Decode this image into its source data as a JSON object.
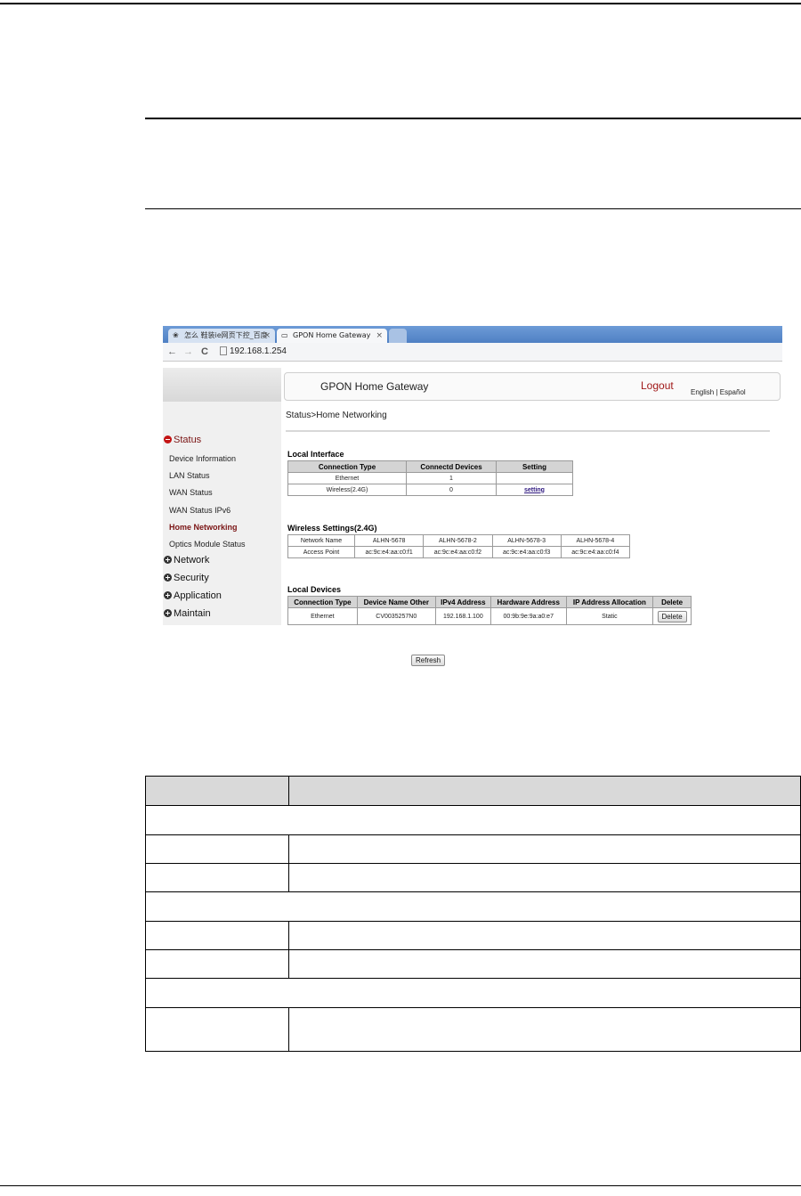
{
  "browser": {
    "tabs": [
      {
        "label": "怎么 鞋装ie网页下控_百度",
        "close": "×"
      },
      {
        "label": "GPON Home Gateway",
        "close": "×"
      }
    ],
    "nav": {
      "back": "←",
      "forward": "→",
      "reload": "C"
    },
    "url": "192.168.1.254"
  },
  "header": {
    "title": "GPON Home Gateway",
    "logout": "Logout",
    "lang": "English | Español"
  },
  "breadcrumb": "Status>Home Networking",
  "sidebar": {
    "status_head": "Status",
    "status_items": [
      "Device Information",
      "LAN Status",
      "WAN Status",
      "WAN Status IPv6",
      "Home Networking",
      "Optics Module Status"
    ],
    "other_heads": [
      "Network",
      "Security",
      "Application",
      "Maintain"
    ]
  },
  "local_interface": {
    "title": "Local Interface",
    "headers": [
      "Connection Type",
      "Connectd Devices",
      "Setting"
    ],
    "rows": [
      [
        "Ethernet",
        "1",
        ""
      ],
      [
        "Wireless(2.4G)",
        "0",
        "setting"
      ]
    ]
  },
  "wireless": {
    "title": "Wireless Settings(2.4G)",
    "rows": [
      [
        "Network Name",
        "ALHN-5678",
        "ALHN-5678-2",
        "ALHN-5678-3",
        "ALHN-5678-4"
      ],
      [
        "Access Point",
        "ac:9c:e4:aa:c0:f1",
        "ac:9c:e4:aa:c0:f2",
        "ac:9c:e4:aa:c0:f3",
        "ac:9c:e4:aa:c0:f4"
      ]
    ]
  },
  "local_devices": {
    "title": "Local Devices",
    "headers": [
      "Connection Type",
      "Device Name Other",
      "IPv4 Address",
      "Hardware Address",
      "IP Address Allocation",
      "Delete"
    ],
    "rows": [
      [
        "Ethernet",
        "CV0035257N0",
        "192.168.1.100",
        "00:9b:9e:9a:a0:e7",
        "Static",
        "Delete"
      ]
    ]
  },
  "refresh": "Refresh"
}
